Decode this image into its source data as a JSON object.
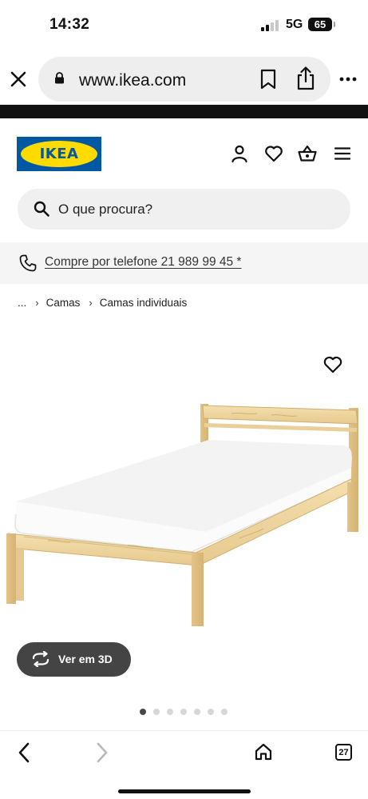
{
  "status_bar": {
    "time": "14:32",
    "network": "5G",
    "battery": "65"
  },
  "browser": {
    "url": "www.ikea.com",
    "open_tabs": "27"
  },
  "site": {
    "logo_text": "IKEA",
    "brand_colors": {
      "blue": "#0058a3",
      "yellow": "#ffdb00"
    },
    "header_icons": [
      "user-icon",
      "heart-icon",
      "basket-icon",
      "menu-icon"
    ]
  },
  "search": {
    "placeholder": "O que procura?"
  },
  "phone_banner": {
    "text": "Compre por telefone 21 989 99 45 *"
  },
  "breadcrumb": {
    "ellipsis": "...",
    "items": [
      "Camas",
      "Camas individuais"
    ]
  },
  "product_gallery": {
    "view_3d_label": "Ver em 3D",
    "image_count": 7,
    "active_index": 0
  }
}
